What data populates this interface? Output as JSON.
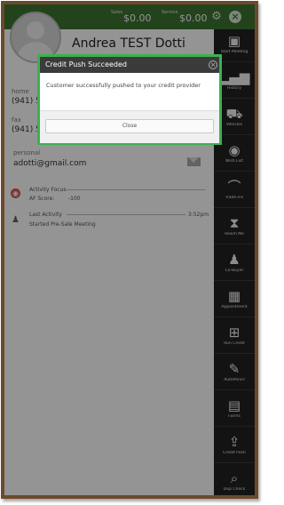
{
  "header": {
    "sales_label": "Sales",
    "sales_value": "$0.00",
    "service_label": "Service",
    "service_value": "$0.00"
  },
  "contact": {
    "name": "Andrea TEST Dotti",
    "home_label": "home",
    "home_value": "(941) 5",
    "fax_label": "fax",
    "fax_value": "(941) 5",
    "personal_label": "personal",
    "email": "adotti@gmail.com"
  },
  "activity": {
    "focus_label": "Activity Focus",
    "score_label": "AF Score:",
    "score_value": "-100",
    "last_label": "Last Activity",
    "last_time": "3:52pm",
    "last_value": "Started Pre-Sale Meeting"
  },
  "sidebar": {
    "items": [
      {
        "label": "Start Meeting",
        "icon": "contact-card-icon"
      },
      {
        "label": "History",
        "icon": "bar-chart-icon"
      },
      {
        "label": "Vehicles",
        "icon": "car-icon"
      },
      {
        "label": "Wish List",
        "icon": "eye-icon"
      },
      {
        "label": "Trade-ins",
        "icon": "trade-icon"
      },
      {
        "label": "Reach Me",
        "icon": "hourglass-icon"
      },
      {
        "label": "Co-Buyer",
        "icon": "cobuyer-icon"
      },
      {
        "label": "Appointment",
        "icon": "calendar-icon"
      },
      {
        "label": "Run Credit",
        "icon": "org-chart-icon"
      },
      {
        "label": "AutoPencil",
        "icon": "pencil-icon"
      },
      {
        "label": "Forms",
        "icon": "document-icon"
      },
      {
        "label": "Credit Push",
        "icon": "upload-icon"
      },
      {
        "label": "Dup Check",
        "icon": "search-icon"
      }
    ]
  },
  "modal": {
    "title": "Credit Push Succeeded",
    "message": "Customer successfully pushed to your credit provider",
    "button_label": "Close"
  },
  "colors": {
    "header_green": "#3c7430",
    "modal_border": "#3ab24f",
    "sidebar_bg": "#222222",
    "frame_brown": "#6b4a2b"
  }
}
